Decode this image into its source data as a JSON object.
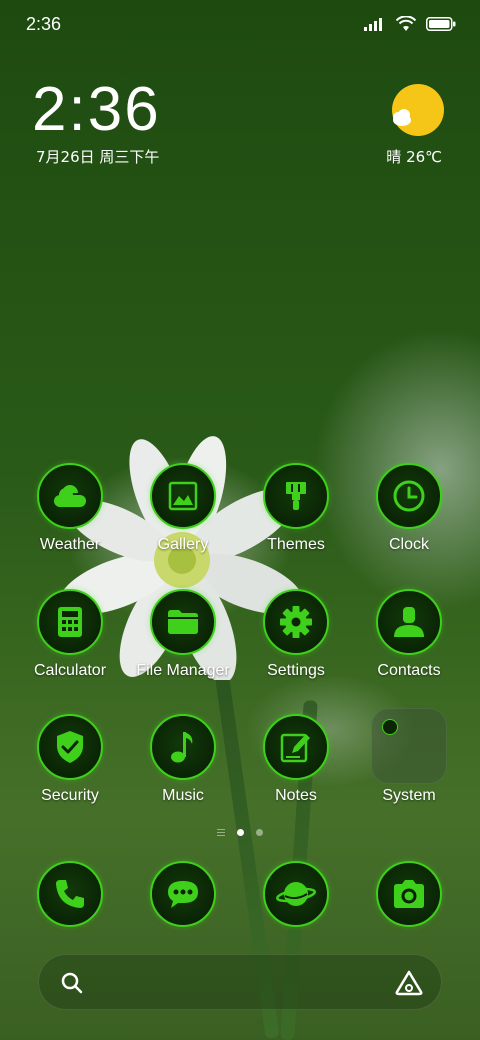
{
  "status_bar": {
    "time": "2:36",
    "icons": [
      "signal-icon",
      "wifi-icon",
      "battery-icon"
    ]
  },
  "clock_widget": {
    "time": "2:36",
    "date": "7月26日 周三下午"
  },
  "weather_widget": {
    "icon": "sun-cloud-icon",
    "text": "晴 26℃"
  },
  "apps": [
    {
      "label": "Weather",
      "icon": "weather-icon"
    },
    {
      "label": "Gallery",
      "icon": "gallery-icon"
    },
    {
      "label": "Themes",
      "icon": "paint-brush-icon"
    },
    {
      "label": "Clock",
      "icon": "clock-icon"
    },
    {
      "label": "Calculator",
      "icon": "calculator-icon"
    },
    {
      "label": "File Manager",
      "icon": "folder-icon"
    },
    {
      "label": "Settings",
      "icon": "gear-icon"
    },
    {
      "label": "Contacts",
      "icon": "person-icon"
    },
    {
      "label": "Security",
      "icon": "shield-check-icon"
    },
    {
      "label": "Music",
      "icon": "music-note-icon"
    },
    {
      "label": "Notes",
      "icon": "notes-pen-icon"
    },
    {
      "label": "System",
      "icon": "folder-icon"
    }
  ],
  "page_indicator": {
    "pages": 2,
    "current": 1
  },
  "dock": [
    {
      "icon": "phone-icon"
    },
    {
      "icon": "message-icon"
    },
    {
      "icon": "browser-planet-icon"
    },
    {
      "icon": "camera-icon"
    }
  ],
  "search_bar": {
    "search_icon": "search-icon",
    "assistant_icon": "assistant-icon"
  },
  "colors": {
    "icon_accent": "#3ed01a",
    "icon_background": "#0a2405"
  }
}
